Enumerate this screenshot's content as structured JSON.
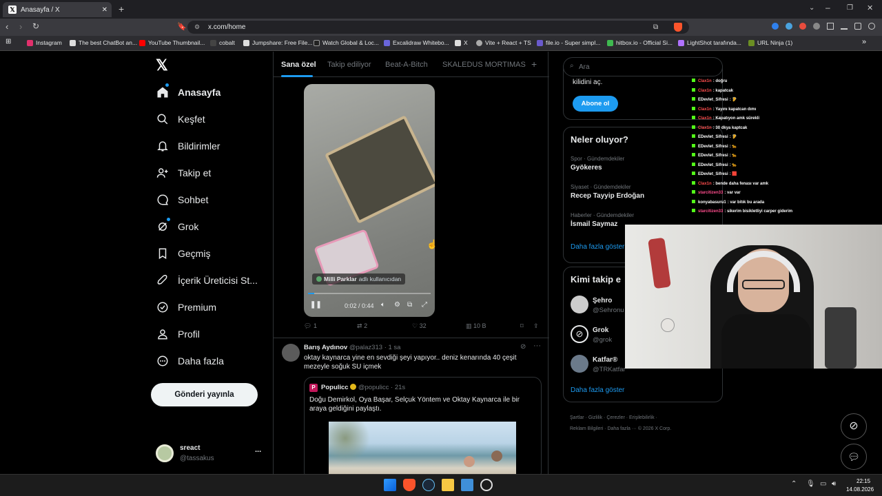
{
  "browser": {
    "tab_title": "Anasayfa / X",
    "new_tab": "+",
    "url": "x.com/home",
    "bookmarks": [
      "Instagram",
      "The best ChatBot an...",
      "YouTube Thumbnail...",
      "cobalt",
      "Jumpshare: Free File...",
      "Watch Global & Loc...",
      "Excalidraw Whitebo...",
      "X",
      "Vite + React + TS",
      "file.io - Super simpl...",
      "hitbox.io - Official Si...",
      "LightShot tarafında...",
      "URL Ninja (1)"
    ]
  },
  "sidebar": {
    "items": [
      {
        "label": "Anasayfa",
        "icon": "home-icon"
      },
      {
        "label": "Keşfet",
        "icon": "search-icon"
      },
      {
        "label": "Bildirimler",
        "icon": "bell-icon"
      },
      {
        "label": "Takip et",
        "icon": "follow-icon"
      },
      {
        "label": "Sohbet",
        "icon": "chat-icon"
      },
      {
        "label": "Grok",
        "icon": "grok-icon"
      },
      {
        "label": "Geçmiş",
        "icon": "bookmark-icon"
      },
      {
        "label": "İçerik Üreticisi St...",
        "icon": "rocket-icon"
      },
      {
        "label": "Premium",
        "icon": "premium-icon"
      },
      {
        "label": "Profil",
        "icon": "profile-icon"
      },
      {
        "label": "Daha fazla",
        "icon": "more-icon"
      }
    ],
    "post_button": "Gönderi yayınla",
    "account": {
      "name": "sreact",
      "handle": "@tassakus",
      "more": "..."
    }
  },
  "main": {
    "tabs": [
      "Sana özel",
      "Takip ediliyor",
      "Beat-A-Bitch",
      "SKALEDUS MORTIMAS"
    ],
    "add_tab": "+",
    "video": {
      "attribution_user": "Milli Parklar",
      "attribution_suffix": "adlı kullanıcıdan",
      "time": "0:02 / 0:44",
      "progress": 0.05
    },
    "post1_actions": {
      "replies": "1",
      "reposts": "2",
      "likes": "32",
      "views": "10 B"
    },
    "post2": {
      "name": "Barış Aydınov",
      "handle": "@palaz313",
      "time": "· 1 sa",
      "text": "oktay kaynarca yine en sevdiği şeyi yapıyor.. deniz kenarında 40 çeşit mezeyle soğuk SU içmek",
      "quote": {
        "name": "Populicc",
        "handle": "@populicc",
        "time": "· 21s",
        "text": "Doğu Demirkol, Oya Başar, Selçuk Yöntem ve Oktay Kaynarca ile bir araya geldiğini paylaştı."
      }
    }
  },
  "right": {
    "search_placeholder": "Ara",
    "premium": {
      "text": "kilidini aç.",
      "button": "Abone ol"
    },
    "trends_title": "Neler oluyor?",
    "trends": [
      {
        "meta": "Spor · Gündemdekiler",
        "name": "Gyökeres"
      },
      {
        "meta": "Siyaset · Gündemdekiler",
        "name": "Recep Tayyip Erdoğan"
      },
      {
        "meta": "Haberler · Gündemdekiler",
        "name": "İsmail Saymaz"
      }
    ],
    "trends_more": "Daha fazla göster",
    "follow_title": "Kimi takip e",
    "follow": [
      {
        "name": "Şehro",
        "handle": "@Sehronu"
      },
      {
        "name": "Grok",
        "handle": "@grok"
      },
      {
        "name": "Katfar®",
        "handle": "@TRKatfar"
      }
    ],
    "follow_more": "Daha fazla göster",
    "footer": [
      "Şartlar",
      "Gizlilik",
      "Çerezler",
      "Erişilebilirlik",
      "Reklam Bilgileri",
      "Daha fazla ···",
      "© 2026 X Corp."
    ]
  },
  "chat": [
    {
      "user": "Clax1n",
      "text": ": doğru",
      "color": "#ff4d4d"
    },
    {
      "user": "Clax1n",
      "text": ": kapatcak",
      "color": "#ff4d4d"
    },
    {
      "user": "EDevlet_Sifresi",
      "text": ": 🦻",
      "color": "#ffffff"
    },
    {
      "user": "Clax1n",
      "text": ": Yayını kapatcan dımı",
      "color": "#ff4d4d"
    },
    {
      "user": "Clax1n",
      "text": ": Kapatıyon amk sürekli",
      "color": "#ff4d4d"
    },
    {
      "user": "Clax1n",
      "text": ": 30 dkya kaptcak",
      "color": "#ff4d4d"
    },
    {
      "user": "EDevlet_Sifresi",
      "text": ": 🦻",
      "color": "#ffffff"
    },
    {
      "user": "EDevlet_Sifresi",
      "text": ": 🐆",
      "color": "#ffffff"
    },
    {
      "user": "EDevlet_Sifresi",
      "text": ": 🐆",
      "color": "#ffffff"
    },
    {
      "user": "EDevlet_Sifresi",
      "text": ": 🐆",
      "color": "#ffffff"
    },
    {
      "user": "EDevlet_Sifresi",
      "text": ": 🟥",
      "color": "#ffffff"
    },
    {
      "user": "Clax1n",
      "text": ": bende daha fenası var amk",
      "color": "#ff4d4d"
    },
    {
      "user": "starcitizen33",
      "text": ": var var",
      "color": "#ff4d8d"
    },
    {
      "user": "konyabasuru1",
      "text": ": var bitık bu arada",
      "color": "#ffffff"
    },
    {
      "user": "starcitizen33",
      "text": ": sikerim bisikletliyi carper giderim",
      "color": "#ff4d8d"
    }
  ],
  "taskbar": {
    "time": "22:15",
    "date": "14.08.2026"
  },
  "colors": {
    "accent": "#1d9bf0",
    "kick": "#53fc18"
  }
}
